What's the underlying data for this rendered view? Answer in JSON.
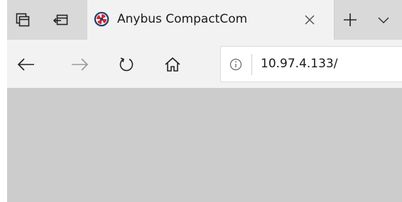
{
  "browser": {
    "tab": {
      "title": "Anybus CompactCom",
      "favicon": "anybus-logo-icon"
    },
    "tabstrip_icons": [
      "tab-actions-icon",
      "tabs-aside-icon",
      "new-tab-icon",
      "tab-list-chevron-icon"
    ],
    "nav_icons": [
      "back-arrow-icon",
      "forward-arrow-icon",
      "refresh-icon",
      "home-icon",
      "info-icon"
    ],
    "address": {
      "url": "10.97.4.133/"
    },
    "colors": {
      "tabstrip_bg": "#d9d9d9",
      "toolbar_bg": "#f2f2f2",
      "content_bg": "#cccccc",
      "favicon_accent": "#d62631",
      "favicon_dark": "#1f3f6e"
    }
  }
}
